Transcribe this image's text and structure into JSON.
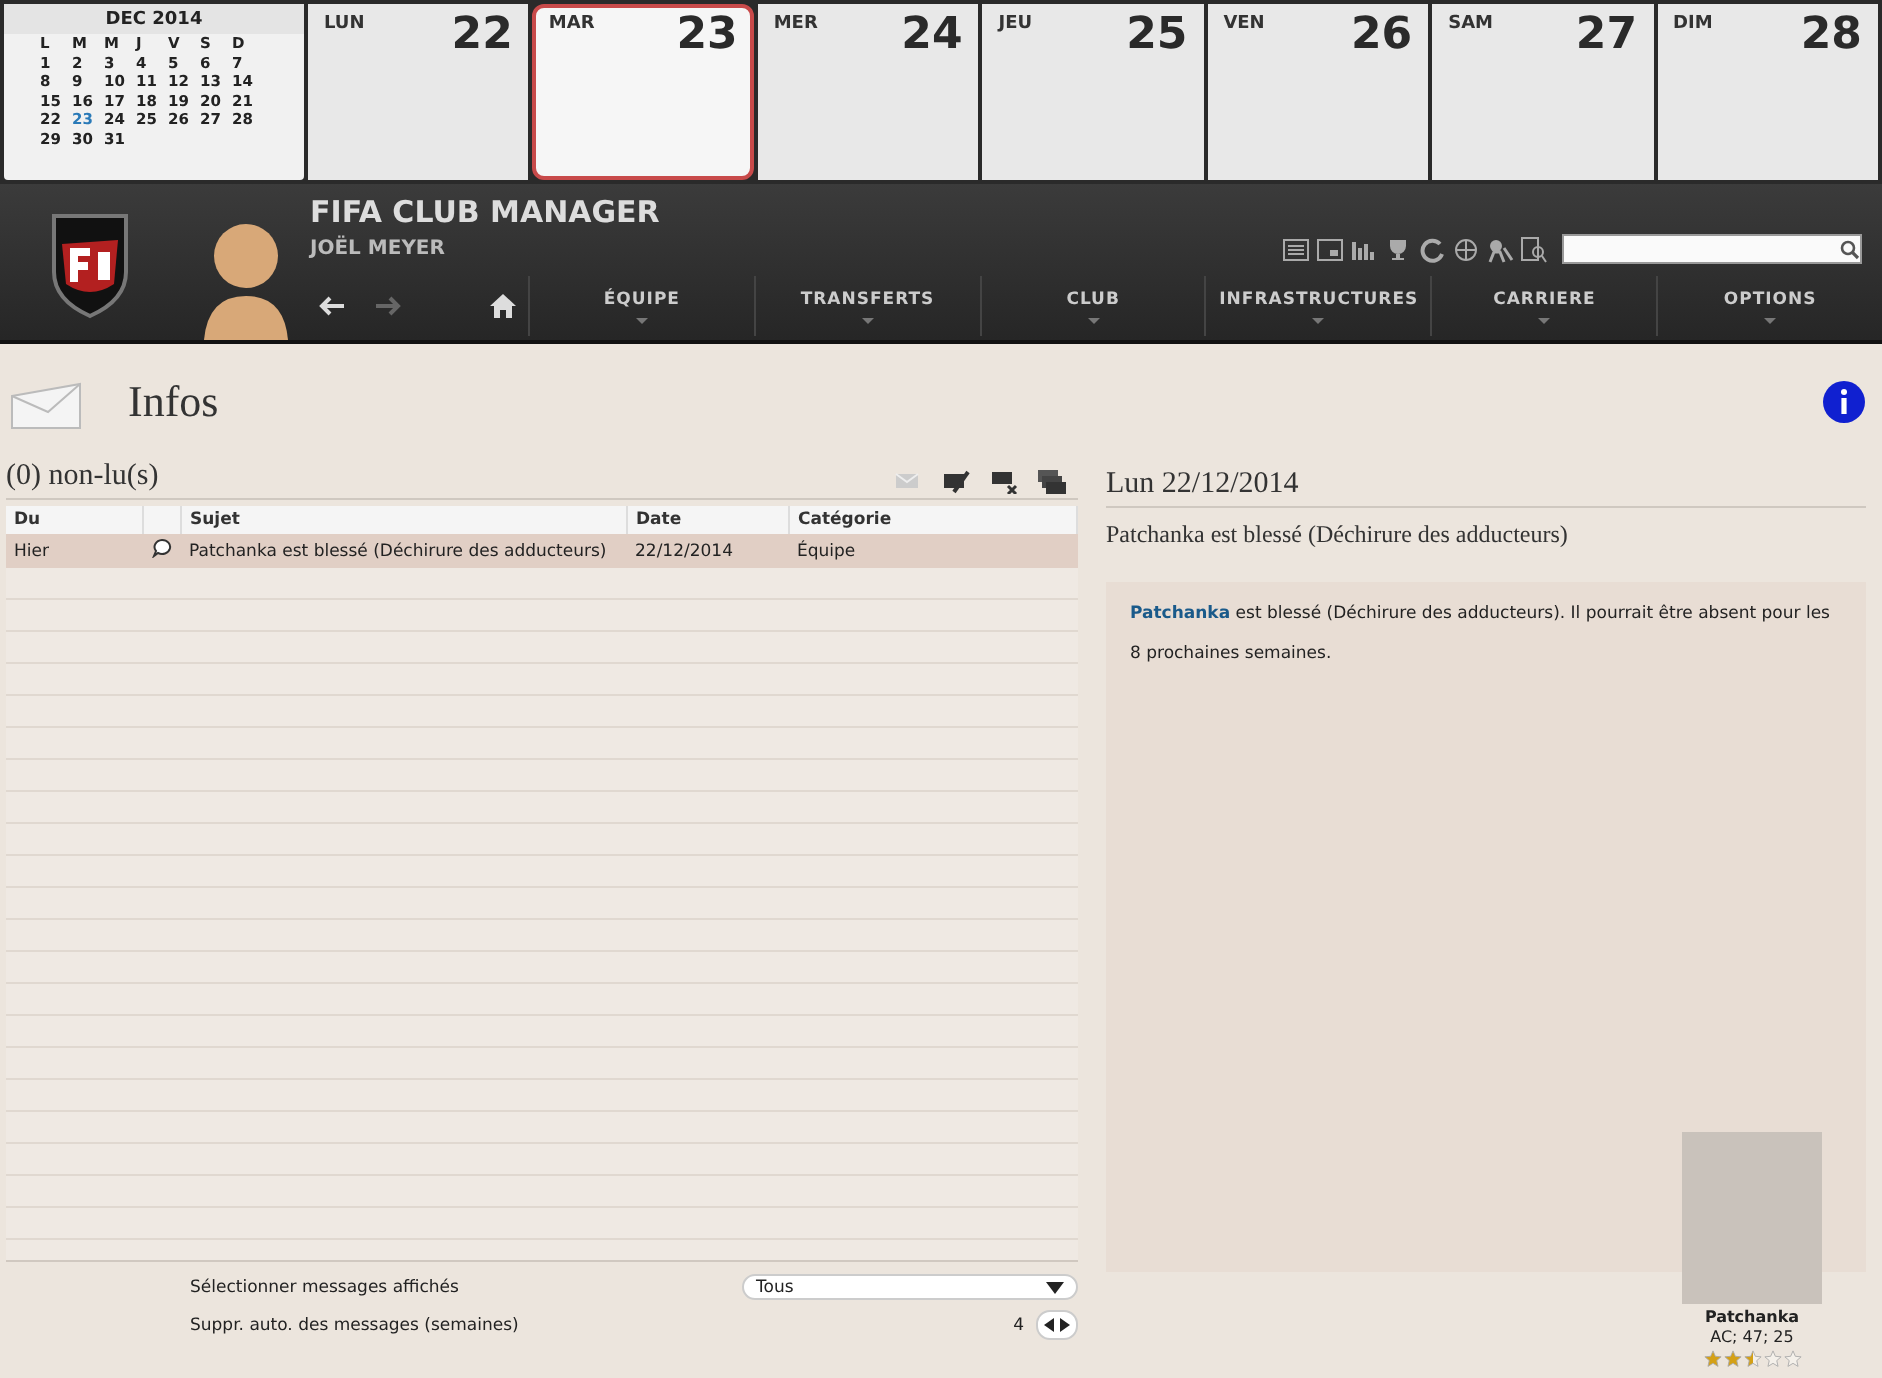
{
  "mini_calendar": {
    "month": "DEC 2014",
    "weekdays": [
      "L",
      "M",
      "M",
      "J",
      "V",
      "S",
      "D"
    ],
    "days": [
      {
        "day": "1",
        "selected": false
      },
      {
        "day": "2",
        "selected": false
      },
      {
        "day": "3",
        "selected": false
      },
      {
        "day": "4",
        "selected": false
      },
      {
        "day": "5",
        "selected": false
      },
      {
        "day": "6",
        "selected": false
      },
      {
        "day": "7",
        "selected": false
      },
      {
        "day": "8",
        "selected": false
      },
      {
        "day": "9",
        "selected": false
      },
      {
        "day": "10",
        "selected": false
      },
      {
        "day": "11",
        "selected": false
      },
      {
        "day": "12",
        "selected": false
      },
      {
        "day": "13",
        "selected": false
      },
      {
        "day": "14",
        "selected": false
      },
      {
        "day": "15",
        "selected": false
      },
      {
        "day": "16",
        "selected": false
      },
      {
        "day": "17",
        "selected": false
      },
      {
        "day": "18",
        "selected": false
      },
      {
        "day": "19",
        "selected": false
      },
      {
        "day": "20",
        "selected": false
      },
      {
        "day": "21",
        "selected": false
      },
      {
        "day": "22",
        "selected": false
      },
      {
        "day": "23",
        "selected": true
      },
      {
        "day": "24",
        "selected": false
      },
      {
        "day": "25",
        "selected": false
      },
      {
        "day": "26",
        "selected": false
      },
      {
        "day": "27",
        "selected": false
      },
      {
        "day": "28",
        "selected": false
      },
      {
        "day": "29",
        "selected": false
      },
      {
        "day": "30",
        "selected": false
      },
      {
        "day": "31",
        "selected": false
      }
    ]
  },
  "week_days": [
    {
      "weekday": "LUN",
      "date": "22",
      "selected": false
    },
    {
      "weekday": "MAR",
      "date": "23",
      "selected": true
    },
    {
      "weekday": "MER",
      "date": "24",
      "selected": false
    },
    {
      "weekday": "JEU",
      "date": "25",
      "selected": false
    },
    {
      "weekday": "VEN",
      "date": "26",
      "selected": false
    },
    {
      "weekday": "SAM",
      "date": "27",
      "selected": false
    },
    {
      "weekday": "DIM",
      "date": "28",
      "selected": false
    }
  ],
  "header": {
    "title": "FIFA CLUB MANAGER",
    "manager": "JOËL MEYER"
  },
  "nav_items": [
    "ÉQUIPE",
    "TRANSFERTS",
    "CLUB",
    "INFRASTRUCTURES",
    "CARRIERE",
    "OPTIONS"
  ],
  "page": {
    "title": "Infos"
  },
  "inbox": {
    "unread": "(0) non-lu(s)",
    "columns": [
      "Du",
      "",
      "Sujet",
      "Date",
      "Catégorie"
    ],
    "rows": [
      {
        "from": "Hier",
        "subject": "Patchanka est blessé (Déchirure des adducteurs)",
        "date": "22/12/2014",
        "category": "Équipe",
        "selected": true
      }
    ]
  },
  "settings": [
    {
      "kind": "select",
      "label": "Sélectionner messages affichés",
      "value": "Tous"
    },
    {
      "kind": "stepper",
      "label": "Suppr. auto. des messages (semaines)",
      "value": "4"
    }
  ],
  "detail": {
    "date": "Lun 22/12/2014",
    "subject": "Patchanka est blessé (Déchirure des adducteurs)",
    "link": "Patchanka",
    "message": " est blessé (Déchirure des adducteurs). Il pourrait être absent pour les 8 prochaines semaines."
  },
  "player": {
    "name": "Patchanka",
    "info": "AC; 47; 25",
    "stars": 2.5
  }
}
